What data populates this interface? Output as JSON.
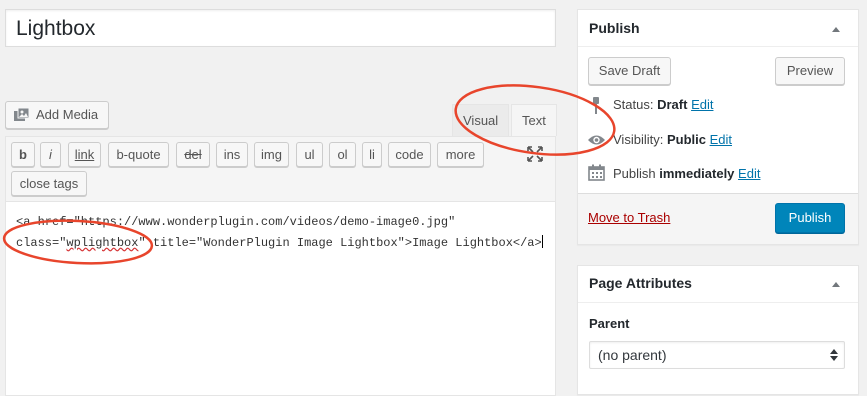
{
  "title": {
    "value": "Lightbox"
  },
  "media": {
    "add_label": "Add Media"
  },
  "editor_tabs": {
    "visual": "Visual",
    "text": "Text"
  },
  "quicktags": {
    "buttons": [
      "b",
      "i",
      "link",
      "b-quote",
      "del",
      "ins",
      "img",
      "ul",
      "ol",
      "li",
      "code",
      "more"
    ],
    "close_tags": "close tags"
  },
  "content": {
    "line1": "<a href=\"https://www.wonderplugin.com/videos/demo-image0.jpg\"",
    "line2_prefix": "class=\"",
    "line2_class": "wplightbox",
    "line2_suffix": "\" title=\"WonderPlugin Image Lightbox\">Image Lightbox</a>"
  },
  "publish": {
    "title": "Publish",
    "save_draft": "Save Draft",
    "preview": "Preview",
    "status_label": "Status:",
    "status_value": "Draft",
    "visibility_label": "Visibility:",
    "visibility_value": "Public",
    "publish_label": "Publish",
    "publish_value": "immediately",
    "edit": "Edit",
    "trash": "Move to Trash",
    "publish_button": "Publish"
  },
  "page_attributes": {
    "title": "Page Attributes",
    "parent_label": "Parent",
    "parent_selected": "(no parent)"
  },
  "colors": {
    "primary": "#0085ba",
    "link": "#0073aa",
    "danger": "#a00",
    "annotation": "#e8452c"
  },
  "icons": {
    "add_media": "media-icon",
    "expand": "fullscreen-icon",
    "status": "pin-icon",
    "visibility": "eye-icon",
    "schedule": "calendar-icon"
  }
}
